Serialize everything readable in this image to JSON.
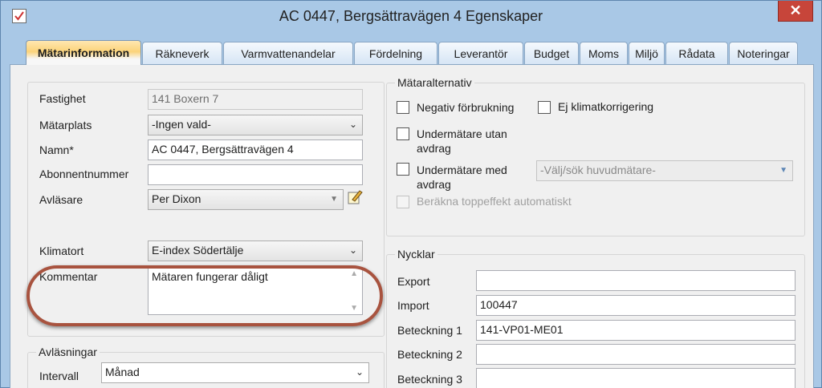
{
  "window": {
    "title": "AC 0447, Bergsättravägen 4 Egenskaper",
    "close_label": "✕",
    "accent": "#c7453a"
  },
  "tabs": [
    {
      "label": "Mätarinformation",
      "active": true
    },
    {
      "label": "Räkneverk"
    },
    {
      "label": "Varmvattenandelar"
    },
    {
      "label": "Fördelning"
    },
    {
      "label": "Leverantör"
    },
    {
      "label": "Budget"
    },
    {
      "label": "Moms"
    },
    {
      "label": "Miljö"
    },
    {
      "label": "Rådata"
    },
    {
      "label": "Noteringar"
    }
  ],
  "info": {
    "fastighet_label": "Fastighet",
    "fastighet_value": "141 Boxern 7",
    "matarplats_label": "Mätarplats",
    "matarplats_value": "-Ingen vald-",
    "namn_label": "Namn*",
    "namn_value": "AC 0447, Bergsättravägen 4",
    "abonnent_label": "Abonnentnummer",
    "abonnent_value": "",
    "avlasare_label": "Avläsare",
    "avlasare_value": "Per Dixon",
    "klimatort_label": "Klimatort",
    "klimatort_value": "E-index Södertälje",
    "kommentar_label": "Kommentar",
    "kommentar_value": "Mätaren fungerar dåligt"
  },
  "alternativ": {
    "title": "Mätaralternativ",
    "negativ": "Negativ förbrukning",
    "klimat": "Ej klimatkorrigering",
    "under_utan": "Undermätare utan\navdrag",
    "under_med": "Undermätare med\navdrag",
    "huvudmatare_placeholder": "-Välj/sök huvudmätare-",
    "topp": "Beräkna toppeffekt automatiskt"
  },
  "nycklar": {
    "title": "Nycklar",
    "rows": [
      {
        "label": "Export",
        "value": ""
      },
      {
        "label": "Import",
        "value": "100447"
      },
      {
        "label": "Beteckning 1",
        "value": "141-VP01-ME01"
      },
      {
        "label": "Beteckning 2",
        "value": ""
      },
      {
        "label": "Beteckning 3",
        "value": ""
      }
    ]
  },
  "avlasningar": {
    "title": "Avläsningar",
    "intervall_label": "Intervall",
    "intervall_value": "Månad"
  }
}
